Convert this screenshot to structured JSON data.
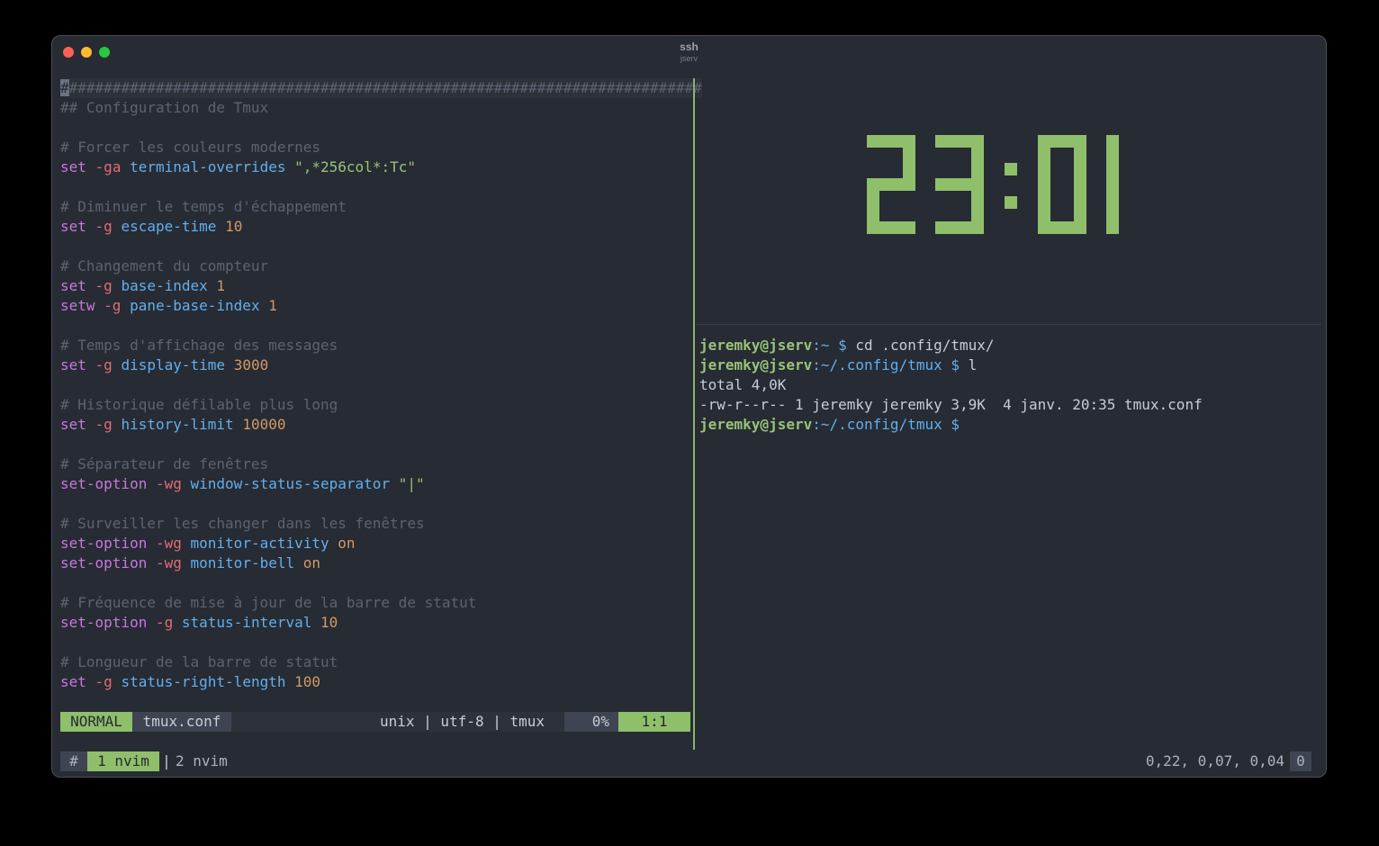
{
  "window": {
    "title": "ssh",
    "subtitle": "jserv"
  },
  "editor": {
    "lines": [
      [
        {
          "t": "#",
          "c": "cursor"
        },
        {
          "t": "#########################################################################",
          "c": "c-com curline"
        }
      ],
      [
        {
          "t": "## Configuration de Tmux",
          "c": "c-com"
        }
      ],
      [],
      [
        {
          "t": "# Forcer les couleurs modernes",
          "c": "c-com"
        }
      ],
      [
        {
          "t": "set",
          "c": "c-kw"
        },
        {
          "t": " "
        },
        {
          "t": "-ga",
          "c": "c-flag"
        },
        {
          "t": " "
        },
        {
          "t": "terminal-overrides",
          "c": "c-opt"
        },
        {
          "t": " "
        },
        {
          "t": "\",*256col*:Tc\"",
          "c": "c-str"
        }
      ],
      [],
      [
        {
          "t": "# Diminuer le temps d'échappement",
          "c": "c-com"
        }
      ],
      [
        {
          "t": "set",
          "c": "c-kw"
        },
        {
          "t": " "
        },
        {
          "t": "-g",
          "c": "c-flag"
        },
        {
          "t": " "
        },
        {
          "t": "escape-time",
          "c": "c-opt"
        },
        {
          "t": " "
        },
        {
          "t": "10",
          "c": "c-num"
        }
      ],
      [],
      [
        {
          "t": "# Changement du compteur",
          "c": "c-com"
        }
      ],
      [
        {
          "t": "set",
          "c": "c-kw"
        },
        {
          "t": " "
        },
        {
          "t": "-g",
          "c": "c-flag"
        },
        {
          "t": " "
        },
        {
          "t": "base-index",
          "c": "c-opt"
        },
        {
          "t": " "
        },
        {
          "t": "1",
          "c": "c-num"
        }
      ],
      [
        {
          "t": "setw",
          "c": "c-kw"
        },
        {
          "t": " "
        },
        {
          "t": "-g",
          "c": "c-flag"
        },
        {
          "t": " "
        },
        {
          "t": "pane-base-index",
          "c": "c-opt"
        },
        {
          "t": " "
        },
        {
          "t": "1",
          "c": "c-num"
        }
      ],
      [],
      [
        {
          "t": "# Temps d'affichage des messages",
          "c": "c-com"
        }
      ],
      [
        {
          "t": "set",
          "c": "c-kw"
        },
        {
          "t": " "
        },
        {
          "t": "-g",
          "c": "c-flag"
        },
        {
          "t": " "
        },
        {
          "t": "display-time",
          "c": "c-opt"
        },
        {
          "t": " "
        },
        {
          "t": "3000",
          "c": "c-num"
        }
      ],
      [],
      [
        {
          "t": "# Historique défilable plus long",
          "c": "c-com"
        }
      ],
      [
        {
          "t": "set",
          "c": "c-kw"
        },
        {
          "t": " "
        },
        {
          "t": "-g",
          "c": "c-flag"
        },
        {
          "t": " "
        },
        {
          "t": "history-limit",
          "c": "c-opt"
        },
        {
          "t": " "
        },
        {
          "t": "10000",
          "c": "c-num"
        }
      ],
      [],
      [
        {
          "t": "# Séparateur de fenêtres",
          "c": "c-com"
        }
      ],
      [
        {
          "t": "set-option",
          "c": "c-kw"
        },
        {
          "t": " "
        },
        {
          "t": "-wg",
          "c": "c-flag"
        },
        {
          "t": " "
        },
        {
          "t": "window-status-separator",
          "c": "c-opt"
        },
        {
          "t": " "
        },
        {
          "t": "\"|\"",
          "c": "c-str"
        }
      ],
      [],
      [
        {
          "t": "# Surveiller les changer dans les fenêtres",
          "c": "c-com"
        }
      ],
      [
        {
          "t": "set-option",
          "c": "c-kw"
        },
        {
          "t": " "
        },
        {
          "t": "-wg",
          "c": "c-flag"
        },
        {
          "t": " "
        },
        {
          "t": "monitor-activity",
          "c": "c-opt"
        },
        {
          "t": " "
        },
        {
          "t": "on",
          "c": "c-num"
        }
      ],
      [
        {
          "t": "set-option",
          "c": "c-kw"
        },
        {
          "t": " "
        },
        {
          "t": "-wg",
          "c": "c-flag"
        },
        {
          "t": " "
        },
        {
          "t": "monitor-bell",
          "c": "c-opt"
        },
        {
          "t": " "
        },
        {
          "t": "on",
          "c": "c-num"
        }
      ],
      [],
      [
        {
          "t": "# Fréquence de mise à jour de la barre de statut",
          "c": "c-com"
        }
      ],
      [
        {
          "t": "set-option",
          "c": "c-kw"
        },
        {
          "t": " "
        },
        {
          "t": "-g",
          "c": "c-flag"
        },
        {
          "t": " "
        },
        {
          "t": "status-interval",
          "c": "c-opt"
        },
        {
          "t": " "
        },
        {
          "t": "10",
          "c": "c-num"
        }
      ],
      [],
      [
        {
          "t": "# Longueur de la barre de statut",
          "c": "c-com"
        }
      ],
      [
        {
          "t": "set",
          "c": "c-kw"
        },
        {
          "t": " "
        },
        {
          "t": "-g",
          "c": "c-flag"
        },
        {
          "t": " "
        },
        {
          "t": "status-right-length",
          "c": "c-opt"
        },
        {
          "t": " "
        },
        {
          "t": "100",
          "c": "c-num"
        }
      ]
    ]
  },
  "vim_status": {
    "mode": "NORMAL",
    "file": "tmux.conf",
    "meta": "unix | utf-8 | tmux",
    "percent": "0%",
    "position": "1:1"
  },
  "clock": {
    "time": "23:01",
    "color": "#8fbf6a"
  },
  "terminal": {
    "lines": [
      [
        {
          "t": "jeremky@jserv",
          "c": "p-user"
        },
        {
          "t": ":~ ",
          "c": "p-path"
        },
        {
          "t": "$ ",
          "c": "p-dollar"
        },
        {
          "t": "cd .config/tmux/"
        }
      ],
      [
        {
          "t": "jeremky@jserv",
          "c": "p-user"
        },
        {
          "t": ":~/.config/tmux ",
          "c": "p-path"
        },
        {
          "t": "$ ",
          "c": "p-dollar"
        },
        {
          "t": "l"
        }
      ],
      [
        {
          "t": "total 4,0K"
        }
      ],
      [
        {
          "t": "-rw-r--r-- 1 jeremky jeremky 3,9K  4 janv. 20:35 tmux.conf"
        }
      ],
      [
        {
          "t": "jeremky@jserv",
          "c": "p-user"
        },
        {
          "t": ":~/.config/tmux ",
          "c": "p-path"
        },
        {
          "t": "$",
          "c": "p-dollar"
        }
      ]
    ]
  },
  "tmux": {
    "hash": "#",
    "active_window": "1 nvim",
    "separator": "|",
    "other_window": "2 nvim",
    "load": "0,22, 0,07, 0,04",
    "counter": "0"
  },
  "colors": {
    "accent_green": "#8fbf6a",
    "background": "#272b33"
  }
}
